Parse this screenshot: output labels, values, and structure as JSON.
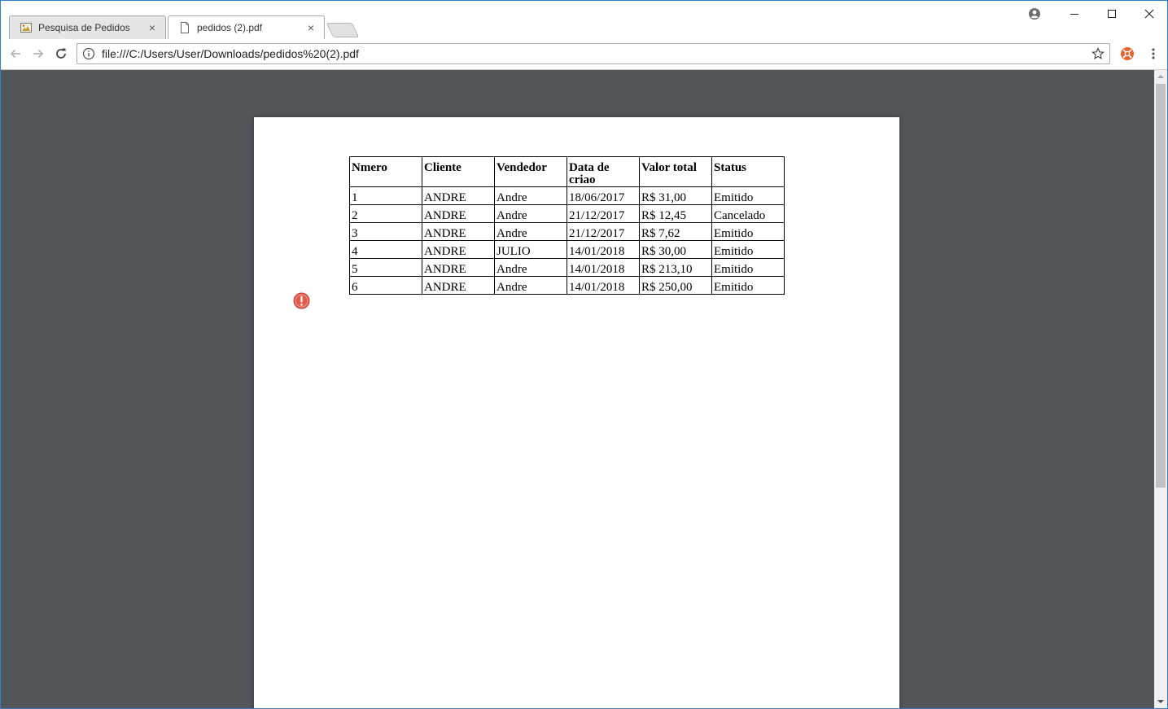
{
  "tabs": [
    {
      "title": "Pesquisa de Pedidos",
      "close": "×"
    },
    {
      "title": "pedidos (2).pdf",
      "close": "×"
    }
  ],
  "address_bar": {
    "url": "file:///C:/Users/User/Downloads/pedidos%20(2).pdf"
  },
  "table": {
    "headers": [
      "Nmero",
      "Cliente",
      "Vendedor",
      "Data de criao",
      "Valor total",
      "Status"
    ],
    "rows": [
      [
        "1",
        "ANDRE",
        "Andre",
        "18/06/2017",
        "R$ 31,00",
        "Emitido"
      ],
      [
        "2",
        "ANDRE",
        "Andre",
        "21/12/2017",
        "R$ 12,45",
        "Cancelado"
      ],
      [
        "3",
        "ANDRE",
        "Andre",
        "21/12/2017",
        "R$ 7,62",
        "Emitido"
      ],
      [
        "4",
        "ANDRE",
        "JULIO",
        "14/01/2018",
        "R$ 30,00",
        "Emitido"
      ],
      [
        "5",
        "ANDRE",
        "Andre",
        "14/01/2018",
        "R$ 213,10",
        "Emitido"
      ],
      [
        "6",
        "ANDRE",
        "Andre",
        "14/01/2018",
        "R$ 250,00",
        "Emitido"
      ]
    ]
  },
  "icons": {
    "tab1_favicon": "image-icon",
    "tab2_favicon": "document-icon",
    "back": "back-arrow-icon",
    "forward": "forward-arrow-icon",
    "reload": "reload-icon",
    "info": "info-icon",
    "bookmark": "star-icon",
    "extension": "extension-icon",
    "menu": "kebab-menu-icon",
    "profile": "profile-icon",
    "annotation": "alert-icon"
  },
  "colors": {
    "viewer_background": "#525659",
    "window_border": "#2b7fd6",
    "extension_accent": "#e8642c",
    "alert": "#e05a4f"
  }
}
